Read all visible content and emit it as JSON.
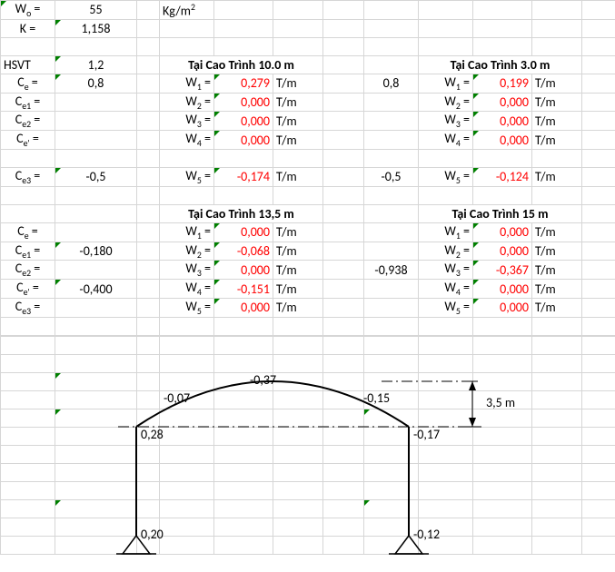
{
  "params": {
    "Wo_label": "W",
    "Wo_sub": "o",
    "Wo_val": "55",
    "Wo_unit_base": "Kg/m",
    "Wo_unit_sup": "2",
    "K_label": "K =",
    "K_val": "1,158",
    "HSVT_label": "HSVT",
    "HSVT_val": "1,2",
    "Ce_label": "C",
    "Ce_sub": "e",
    "Ce_val": "0,8",
    "Ce1_sub": "e1",
    "Ce2_sub": "e2",
    "Cep_sub": "e'",
    "Ce3_sub": "e3",
    "Ce3_val": "-0,5",
    "Ce1_val2": "-0,180",
    "Cep_val2": "-0,400",
    "eq": " ="
  },
  "W": {
    "label": "W",
    "sub1": "1",
    "sub2": "2",
    "sub3": "3",
    "sub4": "4",
    "sub5": "5",
    "eq": " =",
    "unit": "T/m"
  },
  "block10": {
    "title": "Tại Cao Trình 10.0 m",
    "v1": "0,279",
    "v2": "0,000",
    "v3": "0,000",
    "v4": "0,000",
    "v5": "-0,174",
    "side_top": "0,8",
    "side_bot": "-0,5"
  },
  "block3": {
    "title": "Tại Cao Trình 3.0 m",
    "v1": "0,199",
    "v2": "0,000",
    "v3": "0,000",
    "v4": "0,000",
    "v5": "-0,124"
  },
  "block135": {
    "title": "Tại Cao Trình 13,5 m",
    "v1": "0,000",
    "v2": "-0,068",
    "v3": "0,000",
    "v4": "-0,151",
    "v5": "0,000",
    "side": "-0,938"
  },
  "block15": {
    "title": "Tại Cao Trình 15 m",
    "v1": "0,000",
    "v2": "0,000",
    "v3": "-0,367",
    "v4": "0,000",
    "v5": "0,000"
  },
  "diagram": {
    "l_top": "0,28",
    "l_bot": "0,20",
    "r_top": "-0,17",
    "r_bot": "-0,12",
    "arc_l": "-0,07",
    "arc_m": "-0,37",
    "arc_r": "-0,15",
    "height": "3,5 m"
  }
}
